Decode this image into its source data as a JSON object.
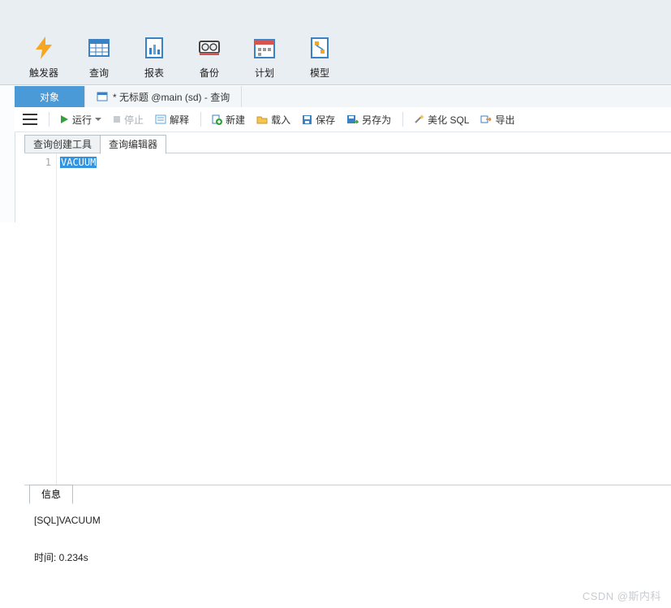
{
  "toolbar": [
    {
      "key": "trigger",
      "label": "触发器"
    },
    {
      "key": "query",
      "label": "查询"
    },
    {
      "key": "report",
      "label": "报表"
    },
    {
      "key": "backup",
      "label": "备份"
    },
    {
      "key": "schedule",
      "label": "计划"
    },
    {
      "key": "model",
      "label": "模型"
    }
  ],
  "tabs": {
    "object": "对象",
    "query_tab": "* 无标题 @main (sd) - 查询"
  },
  "actions": {
    "run": "运行",
    "stop": "停止",
    "explain": "解释",
    "new": "新建",
    "load": "载入",
    "save": "保存",
    "saveas": "另存为",
    "beautify": "美化 SQL",
    "export": "导出"
  },
  "editor_tabs": {
    "builder": "查询创建工具",
    "editor": "查询编辑器"
  },
  "editor": {
    "line_number": "1",
    "content": "VACUUM"
  },
  "output": {
    "tab": "信息",
    "line1": "[SQL]VACUUM",
    "line2": "时间: 0.234s"
  },
  "watermark": "CSDN @斯内科"
}
